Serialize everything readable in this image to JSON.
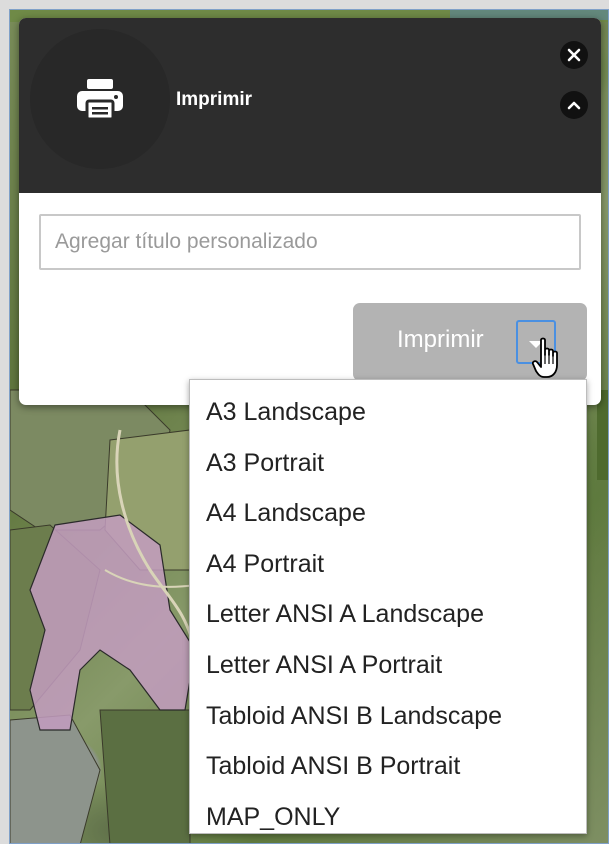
{
  "widget": {
    "title": "Imprimir",
    "icon": "printer-icon",
    "close_icon": "close-icon",
    "collapse_icon": "chevron-up-icon"
  },
  "title_input": {
    "value": "",
    "placeholder": "Agregar título personalizado"
  },
  "print_button": {
    "label": "Imprimir"
  },
  "layout_menu": {
    "items": [
      "A3 Landscape",
      "A3 Portrait",
      "A4 Landscape",
      "A4 Portrait",
      "Letter ANSI A Landscape",
      "Letter ANSI A Portrait",
      "Tabloid ANSI B Landscape",
      "Tabloid ANSI B Portrait",
      "MAP_ONLY"
    ]
  },
  "colors": {
    "header_bg": "#2d2d2d",
    "button_bg": "#b3b3b3",
    "focus_border": "#4a90e2",
    "parcel_highlight": "#c39cc0"
  }
}
